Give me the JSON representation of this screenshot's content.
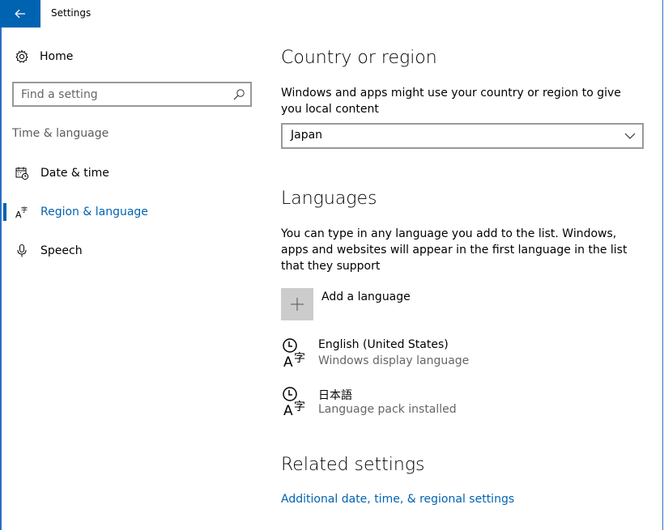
{
  "window": {
    "title": "Settings"
  },
  "nav": {
    "home_label": "Home",
    "search_placeholder": "Find a setting",
    "group_label": "Time & language",
    "items": [
      {
        "label": "Date & time",
        "icon": "calendar-clock-icon"
      },
      {
        "label": "Region & language",
        "icon": "region-language-icon",
        "active": true
      },
      {
        "label": "Speech",
        "icon": "microphone-icon"
      }
    ]
  },
  "country": {
    "heading": "Country or region",
    "description": "Windows and apps might use your country or region to give you local content",
    "selected": "Japan"
  },
  "languages": {
    "heading": "Languages",
    "description": "You can type in any language you add to the list. Windows, apps and websites will appear in the first language in the list that they support",
    "add_label": "Add a language",
    "list": [
      {
        "name": "English (United States)",
        "status": "Windows display language"
      },
      {
        "name": "日本語",
        "status": "Language pack installed"
      }
    ]
  },
  "related": {
    "heading": "Related settings",
    "link": "Additional date, time, & regional settings"
  },
  "colors": {
    "accent": "#0063b1",
    "border": "#999999",
    "secondary_text": "#666666"
  }
}
